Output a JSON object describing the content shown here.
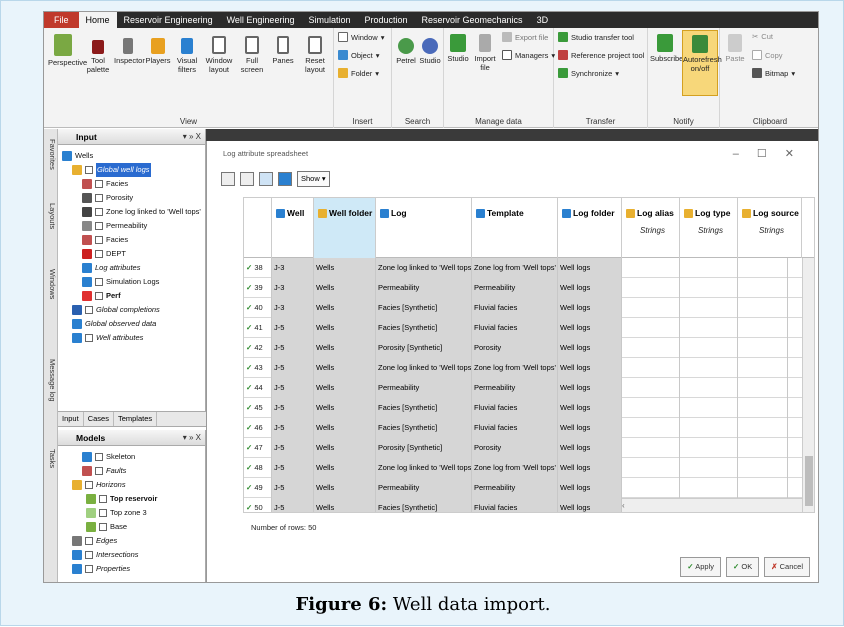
{
  "ribbon_tabs": [
    "File",
    "Home",
    "Reservoir Engineering",
    "Well Engineering",
    "Simulation",
    "Production",
    "Reservoir Geomechanics",
    "3D"
  ],
  "ribbon": {
    "perspective": "Perspective",
    "tool_palette": "Tool palette",
    "inspector": "Inspector",
    "players": "Players",
    "visual_filters": "Visual filters",
    "window_layout": "Window layout",
    "full_screen": "Full screen",
    "panes": "Panes",
    "reset_layout": "Reset layout",
    "view_group": "View",
    "window": "Window",
    "object": "Object",
    "folder": "Folder",
    "insert_group": "Insert",
    "petrel": "Petrel",
    "studio": "Studio",
    "search_group": "Search",
    "studio2": "Studio",
    "import_file": "Import file",
    "export_file": "Export file",
    "managers": "Managers",
    "manage_group": "Manage data",
    "studio_transfer": "Studio transfer tool",
    "reference_project": "Reference project tool",
    "synchronize": "Synchronize",
    "transfer_group": "Transfer",
    "subscribe": "Subscribe",
    "autorefresh": "Autorefresh on/off",
    "notify_group": "Notify",
    "paste": "Paste",
    "cut": "Cut",
    "copy": "Copy",
    "bitmap": "Bitmap",
    "clipboard_group": "Clipboard"
  },
  "side_tabs": [
    "Favorites",
    "Layouts",
    "Windows",
    "Message log",
    "Tasks"
  ],
  "input_panel": {
    "title": "Input",
    "controls": "▾ » X",
    "items": [
      "Wells",
      "Global well logs",
      "Facies",
      "Porosity",
      "Zone log linked to 'Well tops'",
      "Permeability",
      "Facies",
      "DEPT",
      "Log attributes",
      "Simulation Logs",
      "Perf",
      "Global completions",
      "Global observed data",
      "Well attributes"
    ],
    "tabs": [
      "Input",
      "Cases",
      "Templates"
    ]
  },
  "models_panel": {
    "title": "Models",
    "controls": "▾ » X",
    "items": [
      "Skeleton",
      "Faults",
      "Horizons",
      "Top reservoir",
      "Top zone 3",
      "Base",
      "Edges",
      "Intersections",
      "Properties"
    ]
  },
  "dialog": {
    "title": "Log attribute spreadsheet",
    "show_label": "Show",
    "columns": [
      "Well",
      "Well folder",
      "Log",
      "Template",
      "Log folder",
      "Log alias",
      "Log type",
      "Log source"
    ],
    "column_sub": [
      "",
      "",
      "",
      "",
      "",
      "Strings",
      "Strings",
      "Strings"
    ],
    "rows": [
      {
        "n": "38",
        "well": "J-3",
        "folder": "Wells",
        "log": "Zone log linked to 'Well tops'",
        "template": "Zone log from 'Well tops'",
        "logfolder": "Well logs"
      },
      {
        "n": "39",
        "well": "J-3",
        "folder": "Wells",
        "log": "Permeability",
        "template": "Permeability",
        "logfolder": "Well logs"
      },
      {
        "n": "40",
        "well": "J-3",
        "folder": "Wells",
        "log": "Facies [Synthetic]",
        "template": "Fluvial facies",
        "logfolder": "Well logs"
      },
      {
        "n": "41",
        "well": "J-5",
        "folder": "Wells",
        "log": "Facies [Synthetic]",
        "template": "Fluvial facies",
        "logfolder": "Well logs"
      },
      {
        "n": "42",
        "well": "J-5",
        "folder": "Wells",
        "log": "Porosity [Synthetic]",
        "template": "Porosity",
        "logfolder": "Well logs"
      },
      {
        "n": "43",
        "well": "J-5",
        "folder": "Wells",
        "log": "Zone log linked to 'Well tops'",
        "template": "Zone log from 'Well tops'",
        "logfolder": "Well logs"
      },
      {
        "n": "44",
        "well": "J-5",
        "folder": "Wells",
        "log": "Permeability",
        "template": "Permeability",
        "logfolder": "Well logs"
      },
      {
        "n": "45",
        "well": "J-5",
        "folder": "Wells",
        "log": "Facies [Synthetic]",
        "template": "Fluvial facies",
        "logfolder": "Well logs"
      },
      {
        "n": "46",
        "well": "J-5",
        "folder": "Wells",
        "log": "Facies [Synthetic]",
        "template": "Fluvial facies",
        "logfolder": "Well logs"
      },
      {
        "n": "47",
        "well": "J-5",
        "folder": "Wells",
        "log": "Porosity [Synthetic]",
        "template": "Porosity",
        "logfolder": "Well logs"
      },
      {
        "n": "48",
        "well": "J-5",
        "folder": "Wells",
        "log": "Zone log linked to 'Well tops'",
        "template": "Zone log from 'Well tops'",
        "logfolder": "Well logs"
      },
      {
        "n": "49",
        "well": "J-5",
        "folder": "Wells",
        "log": "Permeability",
        "template": "Permeability",
        "logfolder": "Well logs"
      },
      {
        "n": "50",
        "well": "J-5",
        "folder": "Wells",
        "log": "Facies [Synthetic]",
        "template": "Fluvial facies",
        "logfolder": "Well logs"
      }
    ],
    "row_count": "Number of rows: 50",
    "apply": "Apply",
    "ok": "OK",
    "cancel": "Cancel"
  },
  "caption": {
    "label": "Figure 6:",
    "text": " Well data import."
  },
  "colors": {
    "file_tab": "#c0392b",
    "selection": "#2a6bd0",
    "grid_gray": "#d6d6d6",
    "check": "#2c8a2c"
  }
}
